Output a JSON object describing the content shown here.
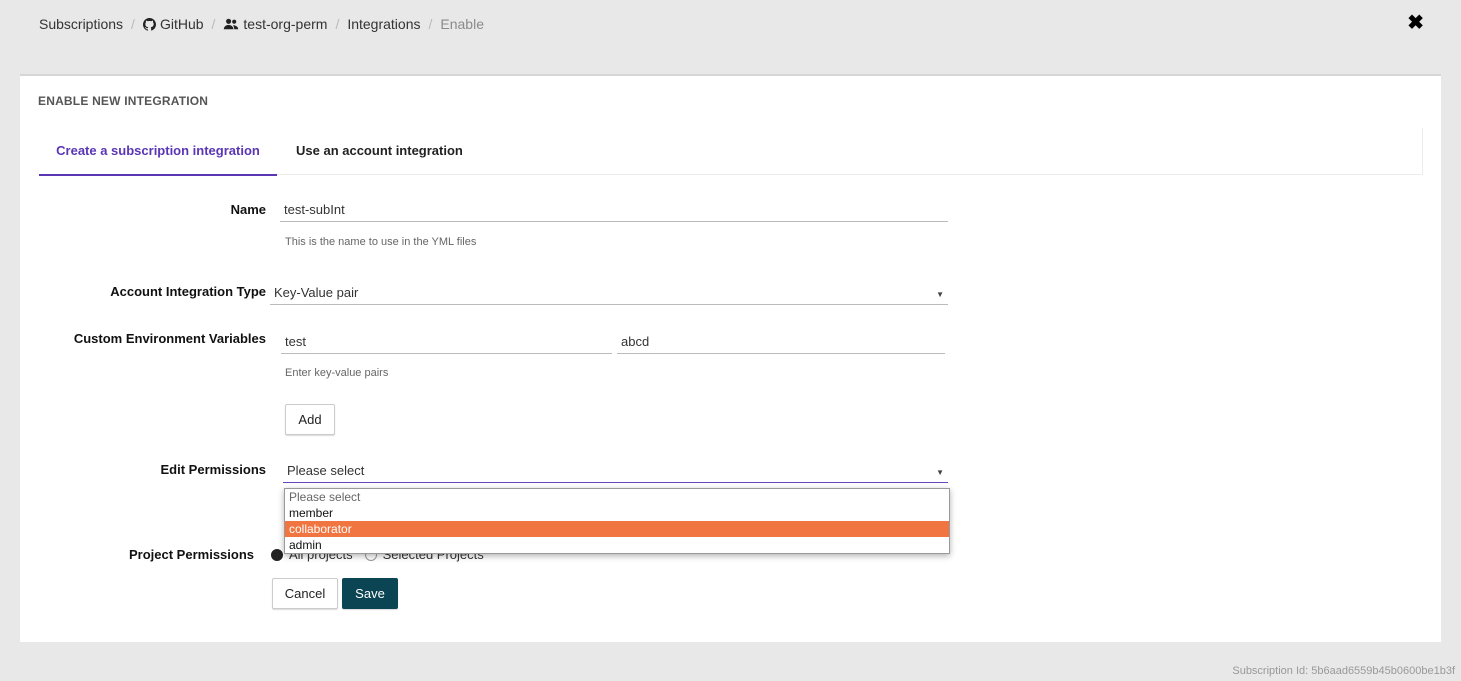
{
  "breadcrumb": {
    "items": [
      "Subscriptions",
      "GitHub",
      "test-org-perm",
      "Integrations",
      "Enable"
    ],
    "separator": "/"
  },
  "card": {
    "title": "ENABLE NEW INTEGRATION",
    "tabs": [
      {
        "label": "Create a subscription integration",
        "active": true
      },
      {
        "label": "Use an account integration",
        "active": false
      }
    ]
  },
  "form": {
    "name": {
      "label": "Name",
      "value": "test-subInt",
      "hint": "This is the name to use in the YML files"
    },
    "type": {
      "label": "Account Integration Type",
      "value": "Key-Value pair"
    },
    "env": {
      "label": "Custom Environment Variables",
      "key": "test",
      "value": "abcd",
      "hint": "Enter key-value pairs",
      "add_label": "Add"
    },
    "edit_permissions": {
      "label": "Edit Permissions",
      "value": "Please select",
      "options": [
        "Please select",
        "member",
        "collaborator",
        "admin"
      ],
      "highlighted": "collaborator"
    },
    "project_permissions": {
      "label": "Project Permissions",
      "options": [
        "All projects",
        "Selected Projects"
      ],
      "selected": "All projects"
    },
    "cancel_label": "Cancel",
    "save_label": "Save"
  },
  "footer": {
    "subscription_id": "Subscription Id: 5b6aad6559b45b0600be1b3f"
  },
  "colors": {
    "accent": "#5a36b5",
    "primary_button": "#0b4452",
    "highlight": "#f07540"
  }
}
